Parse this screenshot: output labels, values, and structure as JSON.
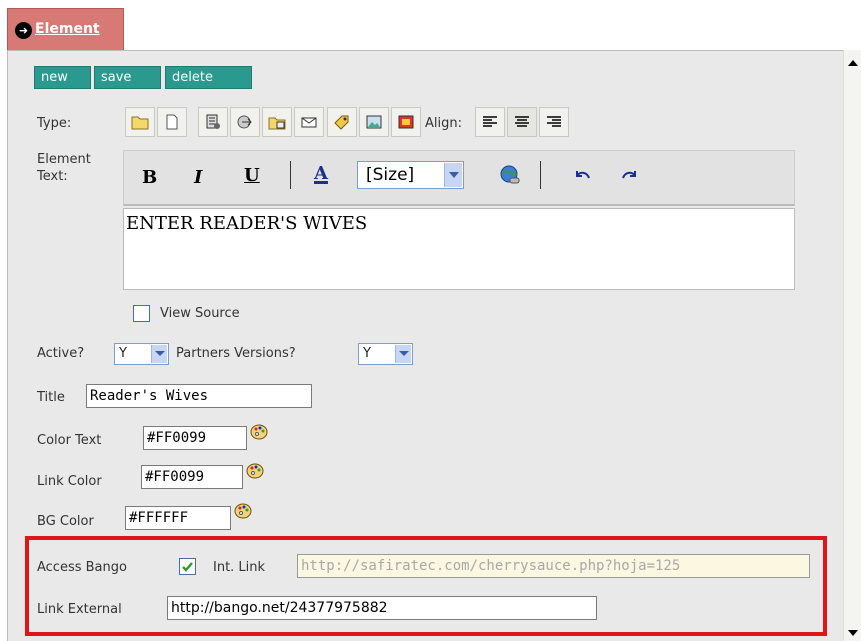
{
  "tab": {
    "label": "Element"
  },
  "actions": {
    "new": "new",
    "save": "save",
    "delete": "delete"
  },
  "type_label": "Type:",
  "align_label": "Align:",
  "element_text_label1": "Element",
  "element_text_label2": "Text:",
  "editor": {
    "bold": "B",
    "italic": "I",
    "underline": "U",
    "font_color": "A",
    "size_select": "[Size]",
    "content": "ENTER READER'S WIVES"
  },
  "view_source_label": "View Source",
  "active": {
    "label": "Active?",
    "value": "Y"
  },
  "partners": {
    "label": "Partners Versions?",
    "value": "Y"
  },
  "title": {
    "label": "Title",
    "value": "Reader's Wives"
  },
  "color_text": {
    "label": "Color Text",
    "value": "#FF0099"
  },
  "link_color": {
    "label": "Link Color",
    "value": "#FF0099"
  },
  "bg_color": {
    "label": "BG Color",
    "value": "#FFFFFF"
  },
  "access_bango": {
    "label": "Access Bango",
    "checked": true
  },
  "int_link": {
    "label": "Int. Link",
    "value": "http://safiratec.com/cherrysauce.php?hoja=125"
  },
  "link_external": {
    "label": "Link External",
    "value": "http://bango.net/24377975882"
  },
  "colors": {
    "accent": "#2a9a8e",
    "tab": "#d77a76",
    "highlight": "#e0151b",
    "panel": "#e9e9e9"
  }
}
